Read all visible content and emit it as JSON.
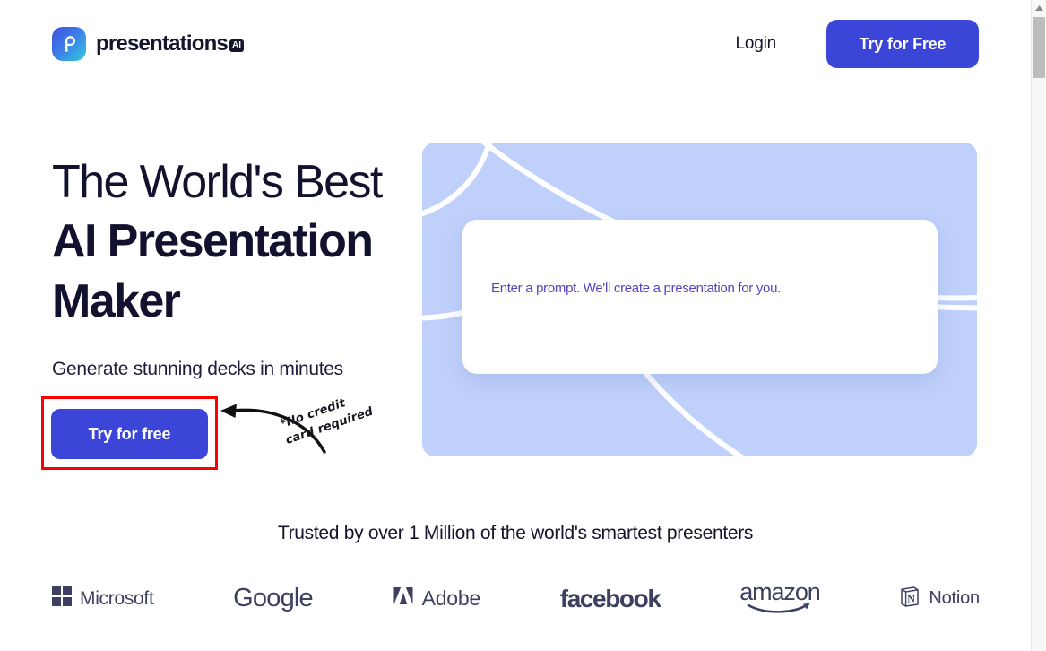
{
  "header": {
    "brand_name": "presentations",
    "brand_chip": "AI",
    "login_label": "Login",
    "cta_label": "Try for Free"
  },
  "hero": {
    "headline_line1": "The World's Best",
    "headline_line2": "AI Presentation",
    "headline_line3": "Maker",
    "subheadline": "Generate stunning decks in minutes",
    "cta_label": "Try for free",
    "annotation_line1": "*No credit",
    "annotation_line2": "card required",
    "prompt_text": "Enter a prompt. We'll create a presentation for you."
  },
  "trusted": {
    "heading": "Trusted by over 1 Million of the world's smartest presenters",
    "logos": [
      {
        "name": "Microsoft",
        "icon": "microsoft-squares-icon"
      },
      {
        "name": "Google",
        "icon": "google-wordmark-icon"
      },
      {
        "name": "Adobe",
        "icon": "adobe-a-icon"
      },
      {
        "name": "facebook",
        "icon": "facebook-wordmark-icon"
      },
      {
        "name": "amazon",
        "icon": "amazon-wordmark-icon"
      },
      {
        "name": "Notion",
        "icon": "notion-cube-icon"
      }
    ]
  },
  "colors": {
    "brand_blue": "#3b45d8",
    "card_blue": "#bfd0fb",
    "prompt_purple": "#5b3fbf",
    "ink": "#14142b",
    "logo_gray": "#3d4060",
    "highlight_red": "#ff0000"
  }
}
